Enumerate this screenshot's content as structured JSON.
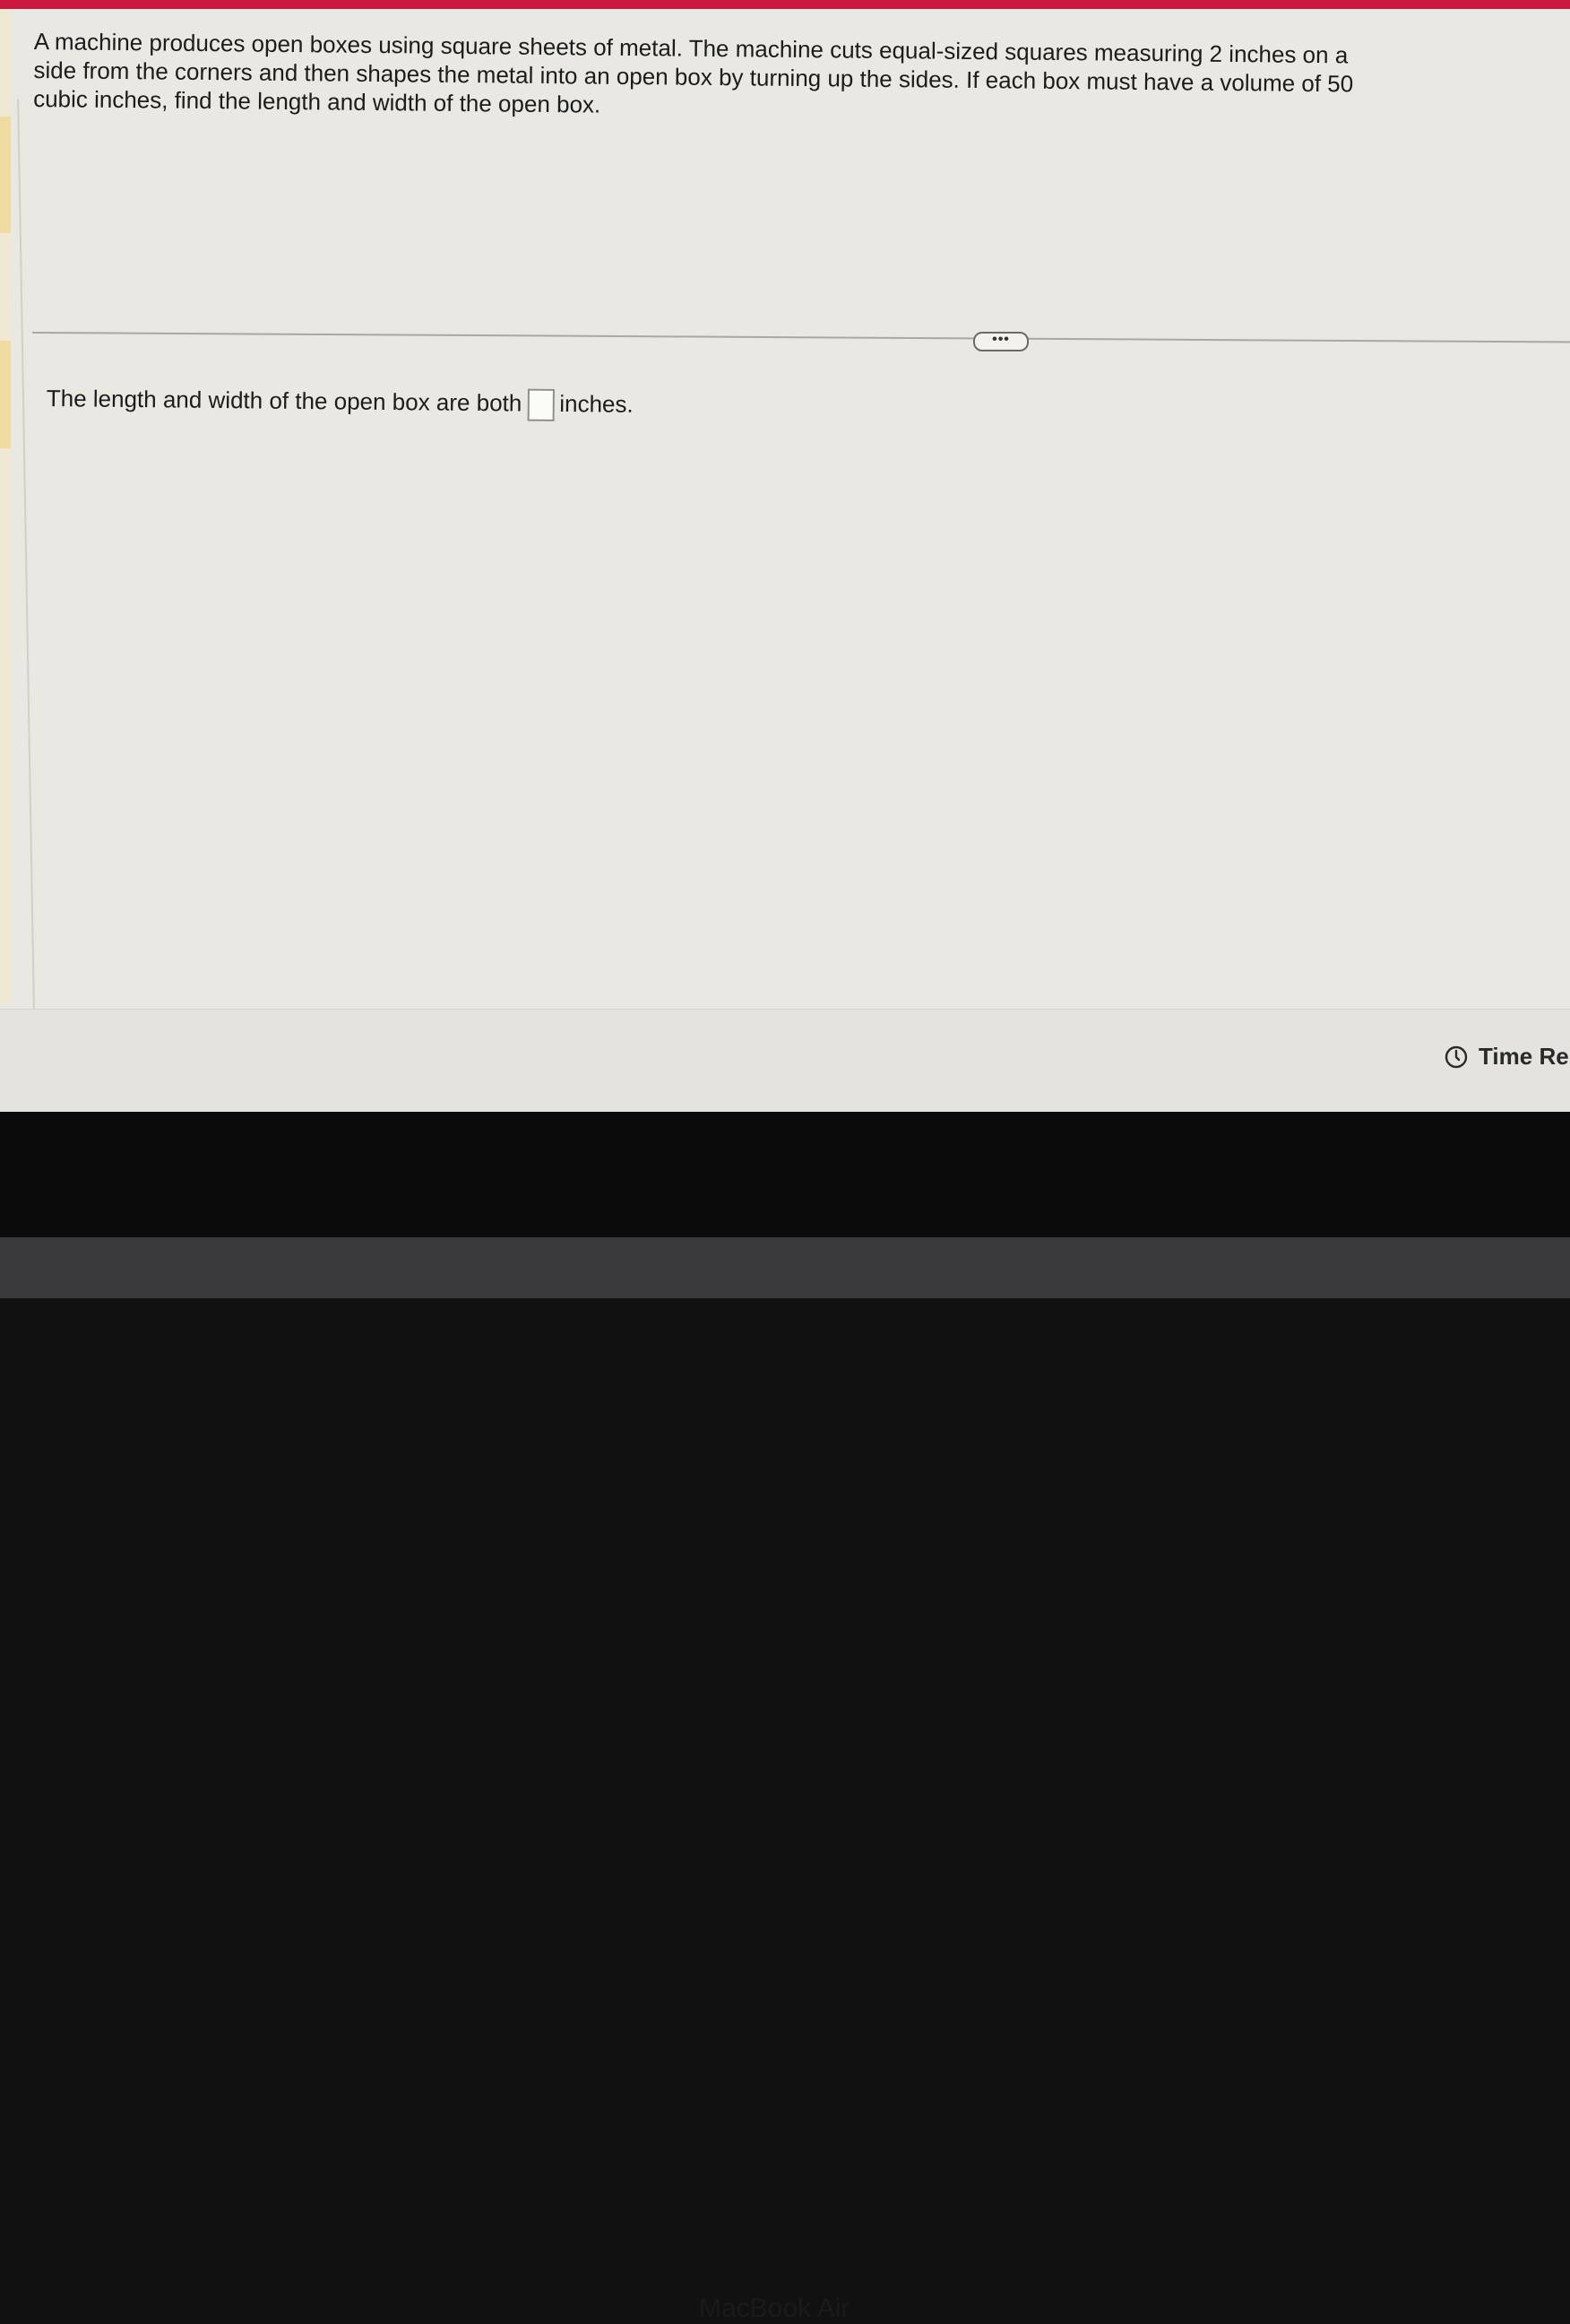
{
  "question": {
    "text": "A machine produces open boxes using square sheets of metal.  The machine cuts equal-sized squares measuring 2 inches on a side from the corners and then shapes the metal into an open box by turning up the sides.  If each box must have a volume of 50 cubic inches, find the length and width of the open box."
  },
  "more_button": {
    "label": "•••"
  },
  "answer": {
    "prefix": "The length and width of the open box are both",
    "value": "",
    "suffix": "inches."
  },
  "footer": {
    "timer_label": "Time Re",
    "clock_icon": "clock-icon"
  },
  "device": {
    "label": "MacBook Air"
  },
  "colors": {
    "accent": "#c9193f",
    "page_background": "#e9e8e2"
  }
}
